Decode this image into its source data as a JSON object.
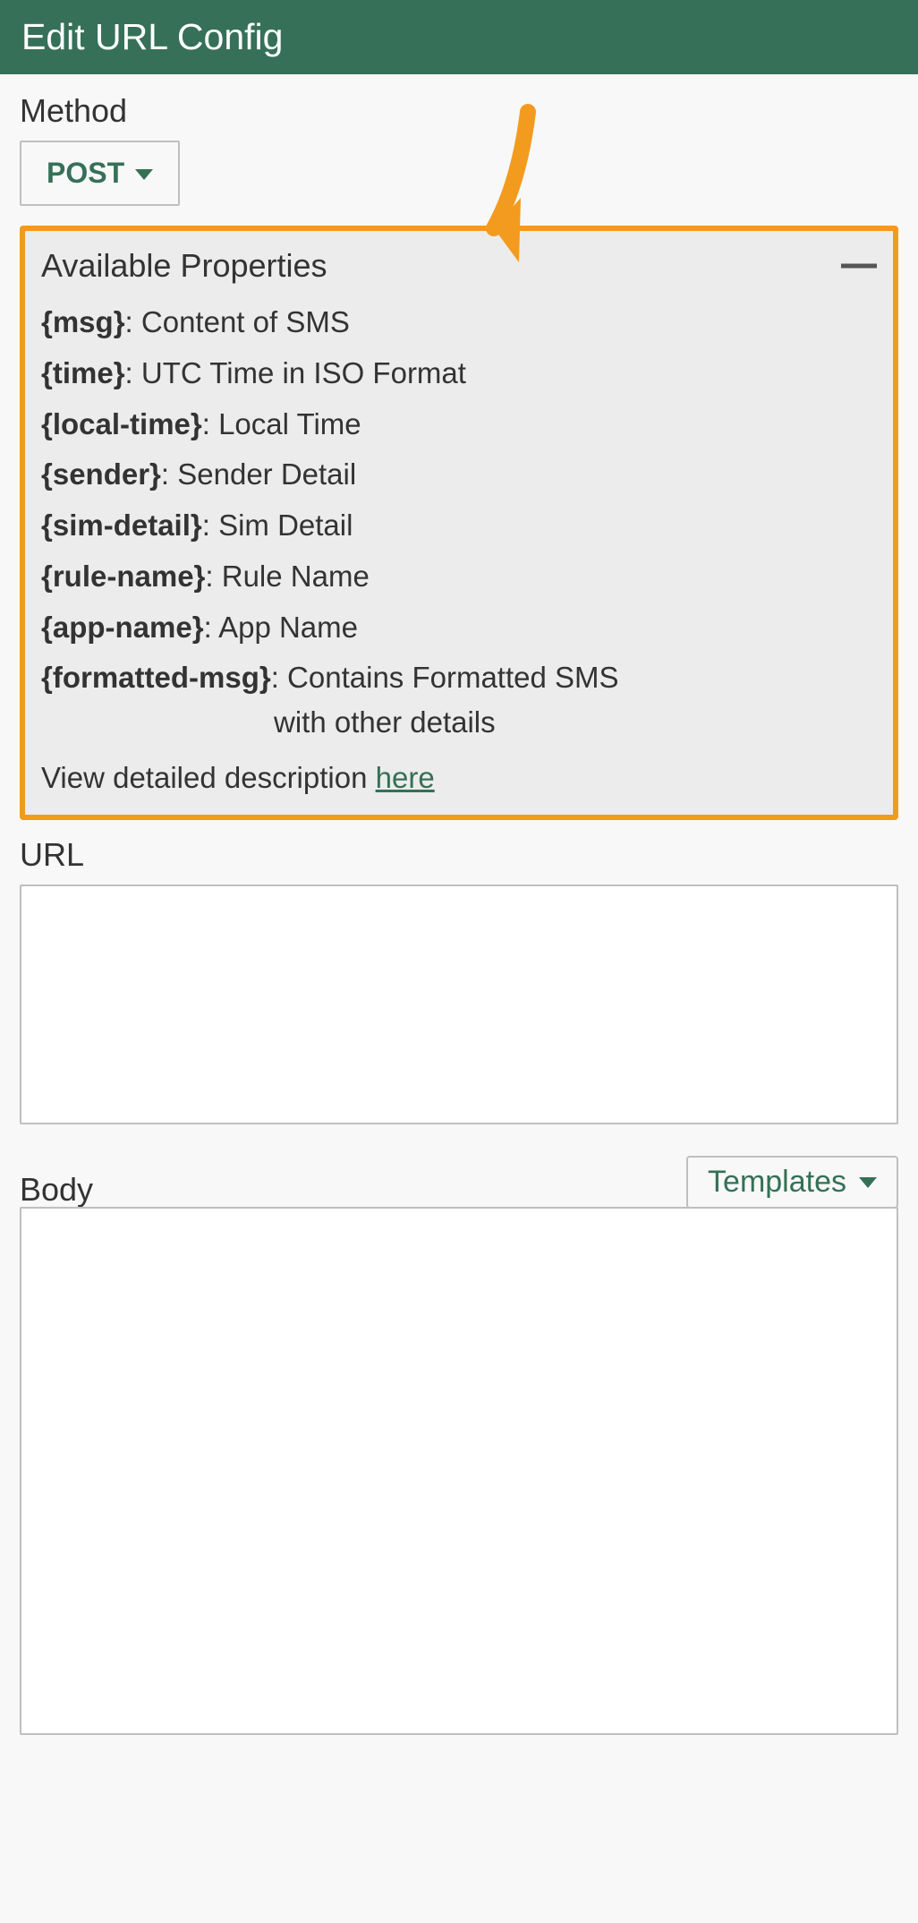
{
  "header": {
    "title": "Edit URL Config"
  },
  "method": {
    "label": "Method",
    "selected": "POST"
  },
  "properties_panel": {
    "title": "Available Properties",
    "items": [
      {
        "key": "{msg}",
        "desc": "Content of SMS"
      },
      {
        "key": "{time}",
        "desc": "UTC Time in ISO Format"
      },
      {
        "key": "{local-time}",
        "desc": "Local Time"
      },
      {
        "key": "{sender}",
        "desc": "Sender Detail"
      },
      {
        "key": "{sim-detail}",
        "desc": "Sim Detail"
      },
      {
        "key": "{rule-name}",
        "desc": "Rule Name"
      },
      {
        "key": "{app-name}",
        "desc": "App Name"
      },
      {
        "key": "{formatted-msg}",
        "desc": "Contains Formatted SMS",
        "desc2": "with other details"
      }
    ],
    "footer_text": "View detailed description ",
    "footer_link": "here"
  },
  "url": {
    "label": "URL",
    "value": ""
  },
  "body_section": {
    "label": "Body",
    "templates_label": "Templates",
    "value": ""
  },
  "colors": {
    "header_bg": "#367059",
    "accent": "#357056",
    "highlight_border": "#f39a1e",
    "arrow": "#f39b1f"
  }
}
